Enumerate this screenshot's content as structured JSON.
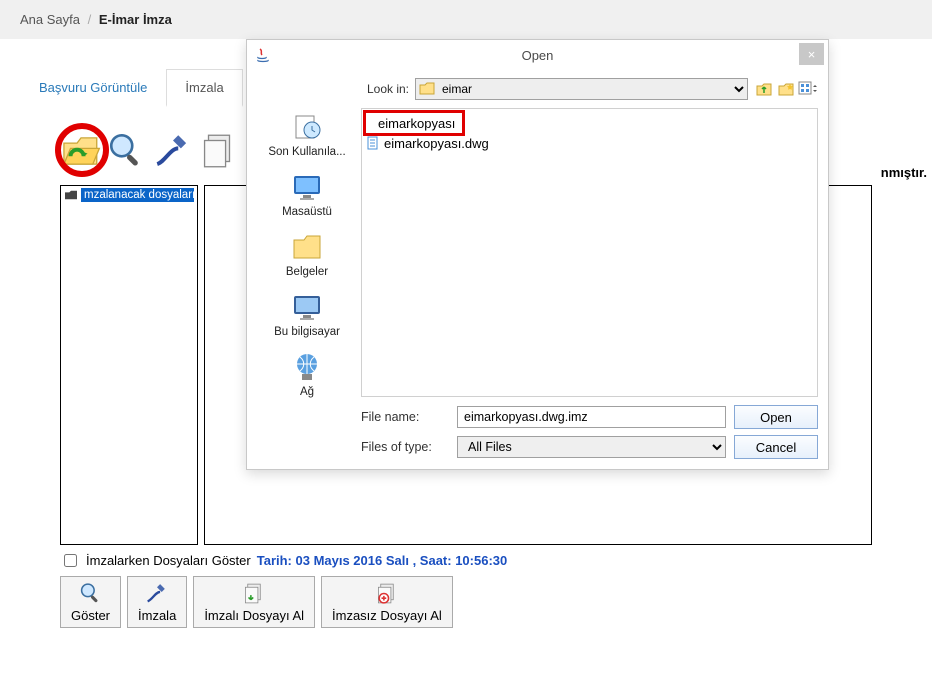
{
  "breadcrumb": {
    "home": "Ana Sayfa",
    "current": "E-İmar İmza"
  },
  "tabs": {
    "view": "Başvuru Görüntüle",
    "sign": "İmzala"
  },
  "truncated": "nmıştır.",
  "left_panel": {
    "selected_label": "mzalanacak dosyaları"
  },
  "bottom": {
    "show_files": "İmzalarken Dosyaları Göster",
    "date": "Tarih: 03 Mayıs 2016 Salı , Saat: 10:56:30",
    "b_goster": "Göster",
    "b_imzala": "İmzala",
    "b_imzali_al": "İmzalı Dosyayı Al",
    "b_imzasiz_al": "İmzasız Dosyayı Al"
  },
  "dialog": {
    "title": "Open",
    "look_in": "Look in:",
    "look_folder": "eimar",
    "sidebar": {
      "recent": "Son Kullanıla...",
      "desktop": "Masaüstü",
      "documents": "Belgeler",
      "thispc": "Bu bilgisayar",
      "network": "Ağ"
    },
    "files": {
      "item1": "eimarkopyası",
      "item2": "eimarkopyası.dwg"
    },
    "filename_label": "File name:",
    "filename_value": "eimarkopyası.dwg.imz",
    "filetype_label": "Files of type:",
    "filetype_value": "All Files",
    "open_btn": "Open",
    "cancel_btn": "Cancel"
  }
}
